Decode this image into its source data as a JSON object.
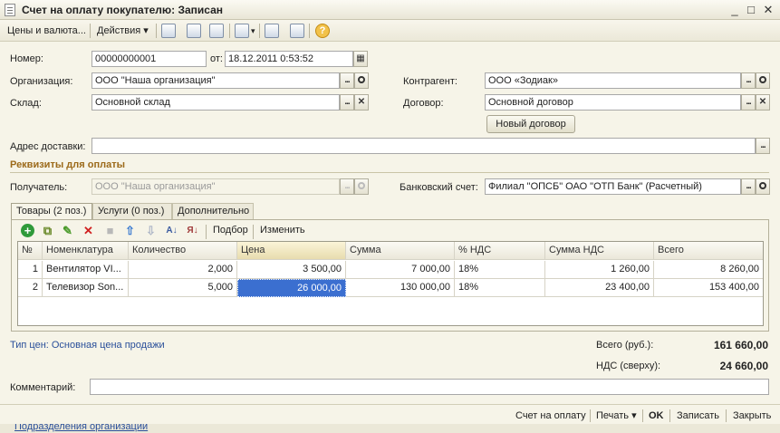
{
  "window": {
    "title": "Счет на оплату покупателю: Записан",
    "controls": [
      "_",
      "□",
      "✕"
    ]
  },
  "toolbar": {
    "prices_label": "Цены и валюта...",
    "actions_label": "Действия",
    "help_label": "?"
  },
  "header": {
    "number_label": "Номер:",
    "number_value": "00000000001",
    "from_label": "от:",
    "date_value": "18.12.2011  0:53:52",
    "org_label": "Организация:",
    "org_value": "ООО \"Наша организация\"",
    "counterparty_label": "Контрагент:",
    "counterparty_value": "ООО «Зодиак»",
    "warehouse_label": "Склад:",
    "warehouse_value": "Основной склад",
    "contract_label": "Договор:",
    "contract_value": "Основной договор",
    "new_contract_button": "Новый договор",
    "address_label": "Адрес доставки:",
    "address_value": ""
  },
  "payment": {
    "section_title": "Реквизиты для оплаты",
    "recipient_label": "Получатель:",
    "recipient_value": "ООО \"Наша организация\"",
    "bank_label": "Банковский счет:",
    "bank_value": "Филиал \"ОПСБ\" ОАО \"ОТП Банк\" (Расчетный)"
  },
  "tabs": [
    {
      "label": "Товары (2 поз.)",
      "active": true
    },
    {
      "label": "Услуги (0 поз.)",
      "active": false
    },
    {
      "label": "Дополнительно",
      "active": false
    }
  ],
  "grid_toolbar": {
    "selection_label": "Подбор",
    "edit_label": "Изменить"
  },
  "table": {
    "columns": [
      "№",
      "Номенклатура",
      "Количество",
      "Цена",
      "Сумма",
      "% НДС",
      "Сумма НДС",
      "Всего"
    ],
    "rows": [
      [
        "1",
        "Вентилятор VI...",
        "2,000",
        "3 500,00",
        "7 000,00",
        "18%",
        "1 260,00",
        "8 260,00"
      ],
      [
        "2",
        "Телевизор Son...",
        "5,000",
        "26 000,00",
        "130 000,00",
        "18%",
        "23 400,00",
        "153 400,00"
      ]
    ]
  },
  "totals": {
    "price_type_link": "Тип цен: Основная цена продажи",
    "total_label": "Всего (руб.):",
    "total_value": "161 660,00",
    "vat_label": "НДС (сверху):",
    "vat_value": "24 660,00"
  },
  "comment": {
    "label": "Комментарий:",
    "value": ""
  },
  "footer": {
    "invoice_button": "Счет на оплату",
    "print_button": "Печать",
    "ok_button": "OK",
    "save_button": "Записать",
    "close_button": "Закрыть"
  },
  "statusbar": {
    "link": "Подразделения организаций"
  },
  "colors": {
    "background": "#f6f4e8",
    "section_title": "#9c6a1a",
    "link": "#2a4f9a",
    "selected_cell": "#3b6fd0"
  },
  "icons": {
    "select": "ellipsis-icon",
    "open": "magnifier-icon",
    "clear": "clear-x-icon",
    "calendar": "calendar-icon"
  }
}
